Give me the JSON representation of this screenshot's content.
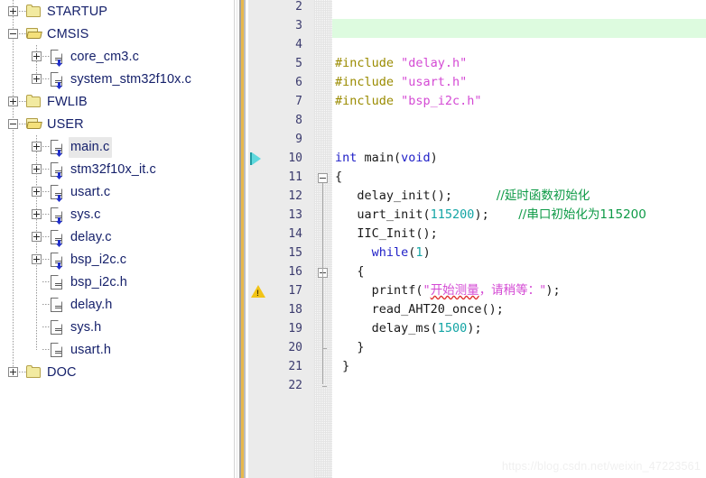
{
  "tree": {
    "items": [
      {
        "label": "STARTUP",
        "type": "folder-closed",
        "expander": "plus",
        "depth": 0,
        "selected": false
      },
      {
        "label": "CMSIS",
        "type": "folder-open",
        "expander": "minus",
        "depth": 0,
        "selected": false
      },
      {
        "label": "core_cm3.c",
        "type": "file-c",
        "expander": "plus",
        "depth": 1,
        "selected": false
      },
      {
        "label": "system_stm32f10x.c",
        "type": "file-c",
        "expander": "plus",
        "depth": 1,
        "selected": false
      },
      {
        "label": "FWLIB",
        "type": "folder-closed",
        "expander": "plus",
        "depth": 0,
        "selected": false
      },
      {
        "label": "USER",
        "type": "folder-open",
        "expander": "minus",
        "depth": 0,
        "selected": false
      },
      {
        "label": "main.c",
        "type": "file-c",
        "expander": "plus",
        "depth": 1,
        "selected": true
      },
      {
        "label": "stm32f10x_it.c",
        "type": "file-c",
        "expander": "plus",
        "depth": 1,
        "selected": false
      },
      {
        "label": "usart.c",
        "type": "file-c",
        "expander": "plus",
        "depth": 1,
        "selected": false
      },
      {
        "label": "sys.c",
        "type": "file-c",
        "expander": "plus",
        "depth": 1,
        "selected": false
      },
      {
        "label": "delay.c",
        "type": "file-c",
        "expander": "plus",
        "depth": 1,
        "selected": false
      },
      {
        "label": "bsp_i2c.c",
        "type": "file-c",
        "expander": "plus",
        "depth": 1,
        "selected": false
      },
      {
        "label": "bsp_i2c.h",
        "type": "file-h",
        "expander": "none",
        "depth": 1,
        "selected": false
      },
      {
        "label": "delay.h",
        "type": "file-h",
        "expander": "none",
        "depth": 1,
        "selected": false
      },
      {
        "label": "sys.h",
        "type": "file-h",
        "expander": "none",
        "depth": 1,
        "selected": false
      },
      {
        "label": "usart.h",
        "type": "file-h",
        "expander": "none",
        "depth": 1,
        "selected": false
      },
      {
        "label": "DOC",
        "type": "folder-closed",
        "expander": "plus",
        "depth": 0,
        "selected": false
      }
    ]
  },
  "editor": {
    "first_line_number": 2,
    "modified_line_number": 3,
    "current_line_marker": 10,
    "warning_line_marker": 17,
    "fold_lines": [
      11,
      16
    ],
    "lines": [
      {
        "n": 2,
        "tokens": []
      },
      {
        "n": 3,
        "tokens": [],
        "modified": true
      },
      {
        "n": 4,
        "tokens": []
      },
      {
        "n": 5,
        "tokens": [
          {
            "t": "#include ",
            "c": "k-pre"
          },
          {
            "t": "\"delay.h\"",
            "c": "k-str"
          }
        ]
      },
      {
        "n": 6,
        "tokens": [
          {
            "t": "#include ",
            "c": "k-pre"
          },
          {
            "t": "\"usart.h\"",
            "c": "k-str"
          }
        ]
      },
      {
        "n": 7,
        "tokens": [
          {
            "t": "#include ",
            "c": "k-pre"
          },
          {
            "t": "\"bsp_i2c.h\"",
            "c": "k-str"
          }
        ]
      },
      {
        "n": 8,
        "tokens": []
      },
      {
        "n": 9,
        "tokens": []
      },
      {
        "n": 10,
        "tokens": [
          {
            "t": "int ",
            "c": "k-kw"
          },
          {
            "t": "main(",
            "c": "k-plain"
          },
          {
            "t": "void",
            "c": "k-kw"
          },
          {
            "t": ")",
            "c": "k-plain"
          }
        ]
      },
      {
        "n": 11,
        "tokens": [
          {
            "t": "{",
            "c": "k-plain"
          }
        ]
      },
      {
        "n": 12,
        "tokens": [
          {
            "t": "   delay_init();      ",
            "c": "k-plain"
          },
          {
            "t": "//延时函数初始化",
            "c": "k-cmt k-cn"
          }
        ]
      },
      {
        "n": 13,
        "tokens": [
          {
            "t": "   uart_init(",
            "c": "k-plain"
          },
          {
            "t": "115200",
            "c": "k-num"
          },
          {
            "t": ");    ",
            "c": "k-plain"
          },
          {
            "t": "//串口初始化为115200",
            "c": "k-cmt k-cn"
          }
        ]
      },
      {
        "n": 14,
        "tokens": [
          {
            "t": "   IIC_Init();",
            "c": "k-plain"
          }
        ]
      },
      {
        "n": 15,
        "tokens": [
          {
            "t": "     ",
            "c": "k-plain"
          },
          {
            "t": "while",
            "c": "k-kw"
          },
          {
            "t": "(",
            "c": "k-plain"
          },
          {
            "t": "1",
            "c": "k-num"
          },
          {
            "t": ")",
            "c": "k-plain"
          }
        ]
      },
      {
        "n": 16,
        "tokens": [
          {
            "t": "   {",
            "c": "k-plain"
          }
        ]
      },
      {
        "n": 17,
        "tokens": [
          {
            "t": "     printf(",
            "c": "k-plain"
          },
          {
            "t": "\"",
            "c": "k-str"
          },
          {
            "t": "开始测量",
            "c": "k-str k-cn squiggle"
          },
          {
            "t": "，请稍等：\"",
            "c": "k-str k-cn"
          },
          {
            "t": ");",
            "c": "k-plain"
          }
        ]
      },
      {
        "n": 18,
        "tokens": [
          {
            "t": "     read_AHT20_once();",
            "c": "k-plain"
          }
        ]
      },
      {
        "n": 19,
        "tokens": [
          {
            "t": "     delay_ms(",
            "c": "k-plain"
          },
          {
            "t": "1500",
            "c": "k-num"
          },
          {
            "t": ");",
            "c": "k-plain"
          }
        ]
      },
      {
        "n": 20,
        "tokens": [
          {
            "t": "   }",
            "c": "k-plain"
          }
        ]
      },
      {
        "n": 21,
        "tokens": [
          {
            "t": " }",
            "c": "k-plain"
          }
        ]
      },
      {
        "n": 22,
        "tokens": []
      }
    ]
  },
  "watermark": {
    "text": "https://blog.csdn.net/weixin_47223561"
  },
  "colors": {
    "preprocessor": "#9a8b00",
    "string": "#d44ad4",
    "keyword": "#2020c8",
    "number": "#14a5a5",
    "comment": "#0d9a46",
    "modified_line": "#ddfbdf",
    "splitter_accent": "#e8b84b",
    "selection": "#e8e8e8",
    "current_marker": "#5fd8dd",
    "warning": "#f2c417"
  }
}
